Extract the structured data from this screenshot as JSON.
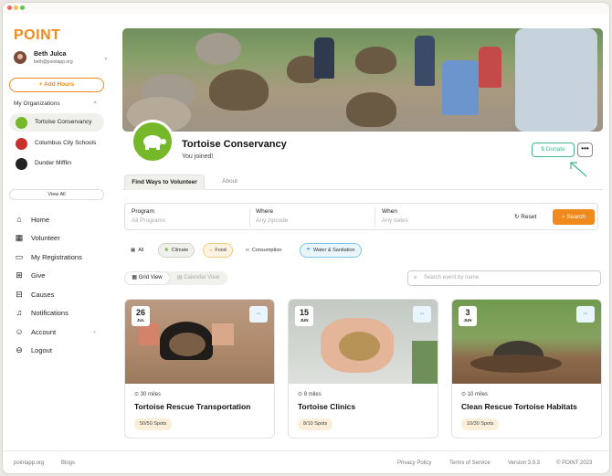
{
  "app": {
    "logo": "POINT"
  },
  "user": {
    "name": "Beth Julca",
    "email": "beth@pointapp.org"
  },
  "sidebar": {
    "add_hours": "+ Add Hours",
    "orgs_heading": "My Organizations",
    "orgs": [
      {
        "label": "Tortoise Conservancy"
      },
      {
        "label": "Columbus City Schools"
      },
      {
        "label": "Dunder Mifflin"
      }
    ],
    "view_all": "View All",
    "nav": [
      {
        "label": "Home",
        "icon": "home-icon"
      },
      {
        "label": "Volunteer",
        "icon": "calendar-icon"
      },
      {
        "label": "My Registrations",
        "icon": "ticket-icon"
      },
      {
        "label": "Give",
        "icon": "gift-icon"
      },
      {
        "label": "Causes",
        "icon": "grid-icon"
      },
      {
        "label": "Notifications",
        "icon": "bell-icon"
      },
      {
        "label": "Account",
        "icon": "user-icon"
      },
      {
        "label": "Logout",
        "icon": "logout-icon"
      }
    ]
  },
  "org": {
    "name": "Tortoise Conservancy",
    "status": "You joined!",
    "donate": "Donate",
    "more": "•••"
  },
  "tabs": [
    {
      "label": "Find Ways to Volunteer"
    },
    {
      "label": "About"
    }
  ],
  "filters": {
    "program": {
      "label": "Program",
      "placeholder": "All Programs"
    },
    "where": {
      "label": "Where",
      "placeholder": "Any zipcode"
    },
    "when": {
      "label": "When",
      "placeholder": "Any dates"
    },
    "reset": "Reset",
    "search": "Search"
  },
  "chips": [
    {
      "label": "All",
      "icon": "grid-icon"
    },
    {
      "label": "Climate",
      "icon": "sun-icon"
    },
    {
      "label": "Food",
      "icon": "bowl-icon"
    },
    {
      "label": "Consumption",
      "icon": "infinity-icon"
    },
    {
      "label": "Water & Sanitation",
      "icon": "water-icon"
    }
  ],
  "view": {
    "grid": "Grid View",
    "calendar": "Calendar View"
  },
  "search_event": {
    "placeholder": "Search event by name"
  },
  "cards": [
    {
      "day": "26",
      "month": "JUL",
      "distance": "30 miles",
      "title": "Tortoise Rescue Transportation",
      "spots": "50/50 Spots"
    },
    {
      "day": "15",
      "month": "JUN",
      "distance": "8 miles",
      "title": "Tortoise Clinics",
      "spots": "8/10 Spots"
    },
    {
      "day": "3",
      "month": "JUN",
      "distance": "10 miles",
      "title": "Clean Rescue Tortoise Habitats",
      "spots": "10/30 Spots"
    }
  ],
  "footer": {
    "site": "pointapp.org",
    "blogs": "Blogs",
    "privacy": "Privacy Policy",
    "terms": "Terms of Service",
    "version": "Version 3.9.3",
    "copyright": "© POINT 2023"
  },
  "colors": {
    "brand_orange": "#f08a1c",
    "donate_green": "#41b88c",
    "org_green": "#77b82a"
  }
}
